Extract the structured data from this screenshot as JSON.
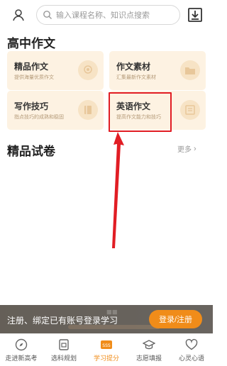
{
  "header": {
    "search_placeholder": "输入课程名称、知识点搜索"
  },
  "section1": {
    "title": "高中作文",
    "cards": [
      {
        "title": "精品作文",
        "subtitle": "提供海量优质作文"
      },
      {
        "title": "作文素材",
        "subtitle": "汇集最新作文素材"
      },
      {
        "title": "写作技巧",
        "subtitle": "指点技巧的成熟和稳固"
      },
      {
        "title": "英语作文",
        "subtitle": "提高作文能力和技巧"
      }
    ]
  },
  "section2": {
    "title": "精品试卷",
    "more_label": "更多"
  },
  "banner": {
    "message": "注册、绑定已有账号登录学习",
    "button_label": "登录/注册"
  },
  "tabbar": {
    "tabs": [
      {
        "label": "走进新高考",
        "icon": "compass-icon"
      },
      {
        "label": "选科规划",
        "icon": "document-icon"
      },
      {
        "label": "学习提分",
        "icon": "study-icon"
      },
      {
        "label": "志愿填报",
        "icon": "graduation-cap-icon"
      },
      {
        "label": "心灵心语",
        "icon": "heart-icon"
      }
    ],
    "active_index": 2
  },
  "colors": {
    "accent": "#f08c19",
    "card_bg": "#fdf2e2",
    "highlight": "#e11d24"
  }
}
